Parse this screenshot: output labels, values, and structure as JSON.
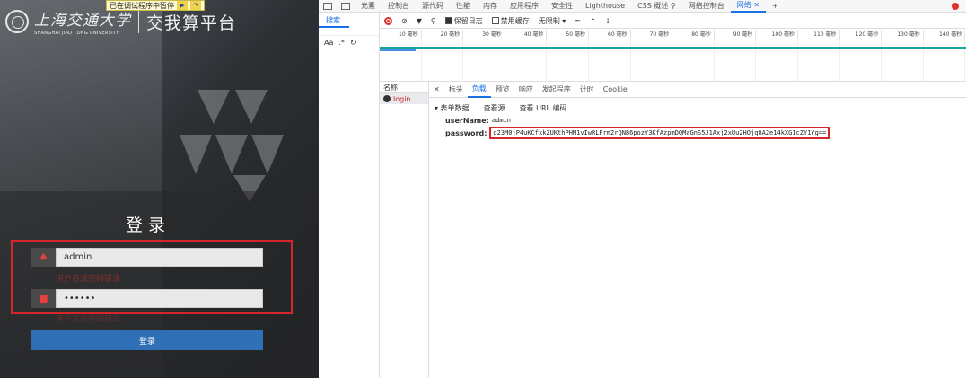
{
  "login_page": {
    "school_name_cn": "上海交通大学",
    "school_name_en": "SHANGHAI JIAO TONG UNIVERSITY",
    "platform_title": "交我算平台",
    "login_title": "登录",
    "username_value": "admin",
    "username_error": "用户名或密码错误",
    "password_value": "••••••",
    "password_error": "用户名或密码错误",
    "login_button": "登录",
    "paused_banner": "已在调试程序中暂停"
  },
  "devtools": {
    "top_tabs": [
      "元素",
      "控制台",
      "源代码",
      "性能",
      "内存",
      "应用程序",
      "安全性",
      "Lighthouse",
      "CSS 概述 ⚲",
      "网络控制台",
      "网络"
    ],
    "active_tab": "网络",
    "search_tab": "搜索",
    "aa_label": "Aa",
    "regex_label": ".*",
    "toolbar": {
      "preserve_log": "保留日志",
      "disable_cache": "禁用缓存",
      "throttling": "无限制"
    },
    "ticks": [
      "10 毫秒",
      "20 毫秒",
      "30 毫秒",
      "40 毫秒",
      "50 毫秒",
      "60 毫秒",
      "70 毫秒",
      "80 毫秒",
      "90 毫秒",
      "100 毫秒",
      "110 毫秒",
      "120 毫秒",
      "130 毫秒",
      "140 毫秒"
    ],
    "name_header": "名称",
    "request_name": "login",
    "detail_tabs": [
      "标头",
      "负载",
      "预览",
      "响应",
      "发起程序",
      "计时",
      "Cookie"
    ],
    "active_detail_tab": "负载",
    "form_data_label": "▾ 表单数据",
    "view_source": "查看源",
    "view_url_encoded": "查看 URL 编码",
    "fields": {
      "username_key": "userName:",
      "username_value": "admin",
      "password_key": "password:",
      "password_value": "g23M0jP4uKCfxkZUKthPHM1vIwRLFrm2rQN86pozY3KfAzpmDQMaGnS5J1Axj2xUu2HOjq0A2e14kXG1cZY1Yg=="
    }
  },
  "colors": {
    "accent_blue": "#1a73e8",
    "highlight_red": "#d6262b",
    "login_button": "#2f6fb5"
  }
}
